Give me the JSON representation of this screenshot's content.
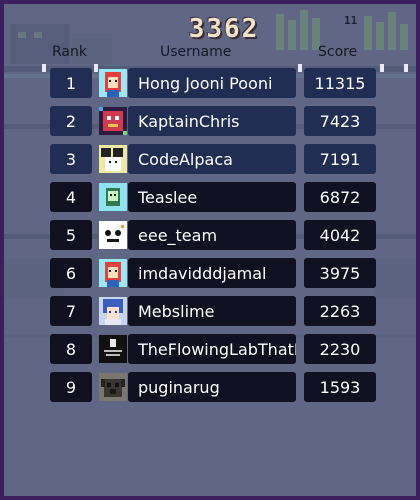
{
  "title": "3362",
  "corner_count": "11",
  "headers": {
    "rank": "Rank",
    "username": "Username",
    "score": "Score"
  },
  "rows": [
    {
      "rank": "1",
      "username": "Hong Jooni Pooni",
      "score": "11315",
      "avatar_icon": "cyan-girl-avatar-icon"
    },
    {
      "rank": "2",
      "username": "KaptainChris",
      "score": "7423",
      "avatar_icon": "red-pixel-avatar-icon"
    },
    {
      "rank": "3",
      "username": "CodeAlpaca",
      "score": "7191",
      "avatar_icon": "alpaca-avatar-icon"
    },
    {
      "rank": "4",
      "username": "Teaslee",
      "score": "6872",
      "avatar_icon": "green-ghost-avatar-icon"
    },
    {
      "rank": "5",
      "username": "eee_team",
      "score": "4042",
      "avatar_icon": "white-face-avatar-icon"
    },
    {
      "rank": "6",
      "username": "imdavidddjamal",
      "score": "3975",
      "avatar_icon": "cyan-girl-avatar-icon"
    },
    {
      "rank": "7",
      "username": "Mebslime",
      "score": "2263",
      "avatar_icon": "anime-avatar-icon"
    },
    {
      "rank": "8",
      "username": "TheFlowingLabThatF",
      "score": "2230",
      "avatar_icon": "dark-logo-avatar-icon"
    },
    {
      "rank": "9",
      "username": "puginarug",
      "score": "1593",
      "avatar_icon": "pug-avatar-icon"
    }
  ],
  "colors": {
    "background": "#616884",
    "border": "#3a1f5c",
    "top_row": "#1f2e52",
    "row": "#0f1020",
    "text": "#ffffff"
  }
}
